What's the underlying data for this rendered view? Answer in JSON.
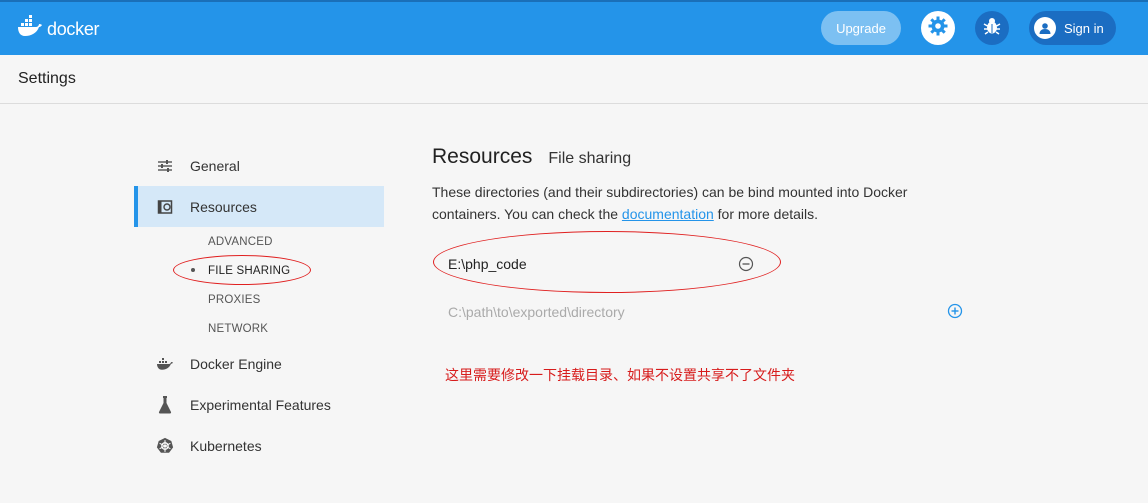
{
  "app": {
    "brand": "docker",
    "upgrade_label": "Upgrade",
    "signin_label": "Sign in",
    "icons": {
      "logo": "docker-whale-icon",
      "settings": "gear-icon",
      "troubleshoot": "bug-icon",
      "user": "user-icon"
    }
  },
  "settings": {
    "title": "Settings"
  },
  "sidebar": {
    "items": [
      {
        "label": "General",
        "icon": "sliders-icon"
      },
      {
        "label": "Resources",
        "icon": "disk-icon",
        "active": true
      },
      {
        "label": "Docker Engine",
        "icon": "whale-icon"
      },
      {
        "label": "Experimental Features",
        "icon": "flask-icon"
      },
      {
        "label": "Kubernetes",
        "icon": "helm-icon"
      }
    ],
    "sub_items": [
      {
        "label": "ADVANCED"
      },
      {
        "label": "FILE SHARING",
        "selected": true
      },
      {
        "label": "PROXIES"
      },
      {
        "label": "NETWORK"
      }
    ]
  },
  "content": {
    "title": "Resources",
    "subtitle": "File sharing",
    "description_before": "These directories (and their subdirectories) can be bind mounted into Docker containers. You can check the ",
    "description_link": "documentation",
    "description_after": " for more details.",
    "directories": [
      "E:\\php_code"
    ],
    "new_path_placeholder": "C:\\path\\to\\exported\\directory",
    "annotation_note": "这里需要修改一下挂载目录、如果不设置共享不了文件夹"
  },
  "colors": {
    "accent": "#2494e9",
    "annotation": "#e02020"
  }
}
